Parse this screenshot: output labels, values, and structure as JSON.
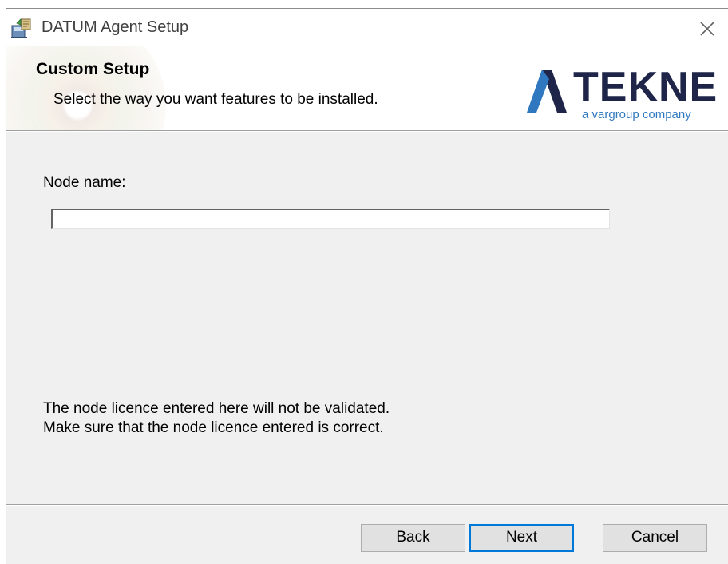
{
  "window": {
    "title": "DATUM Agent Setup"
  },
  "header": {
    "title": "Custom Setup",
    "subtitle": "Select the way you want features to be installed.",
    "logo_word": "TEKNE",
    "logo_tagline": "a vargroup company"
  },
  "form": {
    "node_name_label": "Node name:",
    "node_name_value": "",
    "node_name_placeholder": ""
  },
  "notes": {
    "line1": "The node licence entered here will not be validated.",
    "line2": "Make sure that the node licence entered is correct."
  },
  "buttons": {
    "back": "Back",
    "next": "Next",
    "cancel": "Cancel"
  },
  "icons": {
    "app": "installer-package-icon",
    "close": "close-icon",
    "logo_mark": "tekne-logo-mark"
  },
  "colors": {
    "accent": "#0078d7",
    "logo_dark": "#1e2548",
    "logo_blue": "#2f78bf",
    "dialog_bg": "#f0f0f0"
  }
}
